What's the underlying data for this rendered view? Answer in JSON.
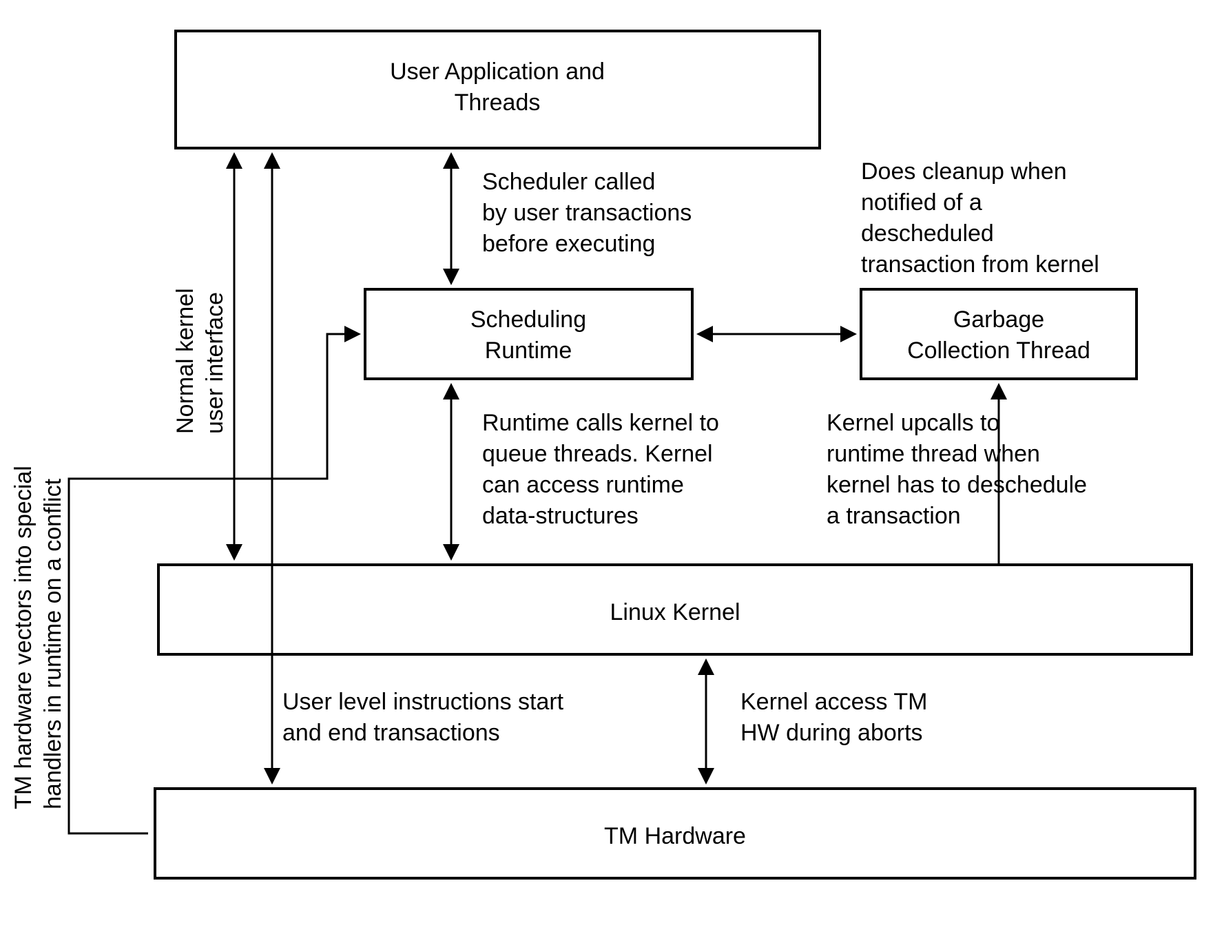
{
  "boxes": {
    "user_app_l1": "User Application and",
    "user_app_l2": "Threads",
    "sched_l1": "Scheduling",
    "sched_l2": "Runtime",
    "gc_l1": "Garbage",
    "gc_l2": "Collection Thread",
    "kernel": "Linux Kernel",
    "tmhw": "TM Hardware"
  },
  "annotations": {
    "sched_called_l1": "Scheduler called",
    "sched_called_l2": "by user transactions",
    "sched_called_l3": "before executing",
    "cleanup_l1": "Does cleanup when",
    "cleanup_l2": "notified of a",
    "cleanup_l3": "descheduled",
    "cleanup_l4": "transaction from kernel",
    "runtime_calls_l1": "Runtime calls kernel to",
    "runtime_calls_l2": "queue threads. Kernel",
    "runtime_calls_l3": "can access runtime",
    "runtime_calls_l4": "data-structures",
    "upcall_l1": "Kernel upcalls to",
    "upcall_l2": "runtime thread when",
    "upcall_l3": "kernel has to deschedule",
    "upcall_l4": "a transaction",
    "userlvl_l1": "User level instructions start",
    "userlvl_l2": "and end transactions",
    "kaccess_l1": "Kernel access TM",
    "kaccess_l2": "HW during aborts",
    "vectors_l1": "TM hardware vectors into special",
    "vectors_l2": "handlers in runtime on a conflict",
    "normal_l1": "Normal kernel",
    "normal_l2": "user interface"
  }
}
